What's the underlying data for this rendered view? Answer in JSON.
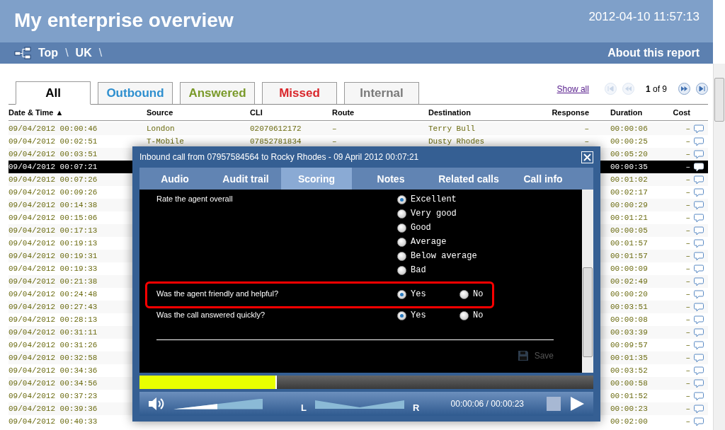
{
  "header": {
    "title": "My enterprise overview",
    "datetime": "2012-04-10 11:57:13"
  },
  "breadcrumb": {
    "items": [
      "Top",
      "\\",
      "UK",
      "\\"
    ],
    "about": "About this report"
  },
  "tabs": [
    {
      "label": "All",
      "selected": true,
      "color": "#000000"
    },
    {
      "label": "Outbound",
      "selected": false,
      "color": "#2e8fcf"
    },
    {
      "label": "Answered",
      "selected": false,
      "color": "#7a9a2a"
    },
    {
      "label": "Missed",
      "selected": false,
      "color": "#d9262b"
    },
    {
      "label": "Internal",
      "selected": false,
      "color": "#7a7a7a"
    }
  ],
  "pager": {
    "show_all": "Show all",
    "page": "**1** of 9",
    "first_disabled": true,
    "prev_disabled": true
  },
  "table": {
    "columns": [
      "Date & Time ▲",
      "Source",
      "CLI",
      "Route",
      "Destination",
      "Response",
      "Duration",
      "Cost"
    ],
    "rows": [
      {
        "datetime": "09/04/2012 00:00:46",
        "source": "London",
        "cli": "02070612172",
        "route": "–",
        "destination": "Terry Bull",
        "response": "–",
        "duration": "00:00:06",
        "cost": "–",
        "selected": false
      },
      {
        "datetime": "09/04/2012 00:02:51",
        "source": "T-Mobile",
        "cli": "07852781834",
        "route": "–",
        "destination": "Dusty Rhodes",
        "response": "–",
        "duration": "00:00:25",
        "cost": "–",
        "selected": false
      },
      {
        "datetime": "09/04/2012 00:03:51",
        "duration": "00:05:20",
        "cost": "–",
        "selected": false
      },
      {
        "datetime": "09/04/2012 00:07:21",
        "duration": "00:00:35",
        "cost": "–",
        "selected": true
      },
      {
        "datetime": "09/04/2012 00:07:26",
        "duration": "00:01:02",
        "cost": "–",
        "selected": false
      },
      {
        "datetime": "09/04/2012 00:09:26",
        "duration": "00:02:17",
        "cost": "–",
        "selected": false
      },
      {
        "datetime": "09/04/2012 00:14:38",
        "duration": "00:00:29",
        "cost": "–",
        "selected": false
      },
      {
        "datetime": "09/04/2012 00:15:06",
        "duration": "00:01:21",
        "cost": "–",
        "selected": false
      },
      {
        "datetime": "09/04/2012 00:17:13",
        "duration": "00:00:05",
        "cost": "–",
        "selected": false
      },
      {
        "datetime": "09/04/2012 00:19:13",
        "duration": "00:01:57",
        "cost": "–",
        "selected": false
      },
      {
        "datetime": "09/04/2012 00:19:31",
        "duration": "00:01:57",
        "cost": "–",
        "selected": false
      },
      {
        "datetime": "09/04/2012 00:19:33",
        "duration": "00:00:09",
        "cost": "–",
        "selected": false
      },
      {
        "datetime": "09/04/2012 00:21:38",
        "duration": "00:02:49",
        "cost": "–",
        "selected": false
      },
      {
        "datetime": "09/04/2012 00:24:48",
        "duration": "00:00:20",
        "cost": "–",
        "selected": false
      },
      {
        "datetime": "09/04/2012 00:27:43",
        "duration": "00:03:51",
        "cost": "–",
        "selected": false
      },
      {
        "datetime": "09/04/2012 00:28:13",
        "duration": "00:00:08",
        "cost": "–",
        "selected": false
      },
      {
        "datetime": "09/04/2012 00:31:11",
        "duration": "00:03:39",
        "cost": "–",
        "selected": false
      },
      {
        "datetime": "09/04/2012 00:31:26",
        "duration": "00:09:57",
        "cost": "–",
        "selected": false
      },
      {
        "datetime": "09/04/2012 00:32:58",
        "duration": "00:01:35",
        "cost": "–",
        "selected": false
      },
      {
        "datetime": "09/04/2012 00:34:36",
        "duration": "00:03:52",
        "cost": "–",
        "selected": false
      },
      {
        "datetime": "09/04/2012 00:34:56",
        "duration": "00:00:58",
        "cost": "–",
        "selected": false
      },
      {
        "datetime": "09/04/2012 00:37:23",
        "duration": "00:01:52",
        "cost": "–",
        "selected": false
      },
      {
        "datetime": "09/04/2012 00:39:36",
        "duration": "00:00:23",
        "cost": "–",
        "selected": false
      },
      {
        "datetime": "09/04/2012 00:40:33",
        "duration": "00:02:00",
        "cost": "–",
        "selected": false
      }
    ]
  },
  "dialog": {
    "title": "Inbound call from 07957584564 to Rocky Rhodes - 09 April 2012 00:07:21",
    "tabs": [
      {
        "label": "Audio",
        "selected": false
      },
      {
        "label": "Audit trail",
        "selected": false
      },
      {
        "label": "Scoring",
        "selected": true
      },
      {
        "label": "Notes",
        "selected": false
      },
      {
        "label": "Related calls",
        "selected": false
      },
      {
        "label": "Call info",
        "selected": false
      }
    ],
    "questions": [
      {
        "kind": "scale",
        "text": "Rate the agent overall",
        "highlighted": false,
        "options": [
          {
            "label": "Excellent",
            "selected": true
          },
          {
            "label": "Very good",
            "selected": false
          },
          {
            "label": "Good",
            "selected": false
          },
          {
            "label": "Average",
            "selected": false
          },
          {
            "label": "Below average",
            "selected": false
          },
          {
            "label": "Bad",
            "selected": false
          }
        ]
      },
      {
        "kind": "yes_no",
        "text": "Was the agent friendly and helpful?",
        "highlighted": true,
        "options": [
          {
            "label": "Yes",
            "selected": true
          },
          {
            "label": "No",
            "selected": false
          }
        ]
      },
      {
        "kind": "yes_no",
        "text": "Was the call answered quickly?",
        "highlighted": false,
        "options": [
          {
            "label": "Yes",
            "selected": true
          },
          {
            "label": "No",
            "selected": false
          }
        ]
      }
    ],
    "save": {
      "label": "Save",
      "disabled": true
    },
    "player": {
      "progress": {
        "level": 0.3
      },
      "volume": {
        "level": 0.49
      },
      "balance": {
        "level": 0.5
      },
      "balance_left": "L",
      "balance_right": "R",
      "time": "00:00:06 / 00:00:23"
    }
  }
}
